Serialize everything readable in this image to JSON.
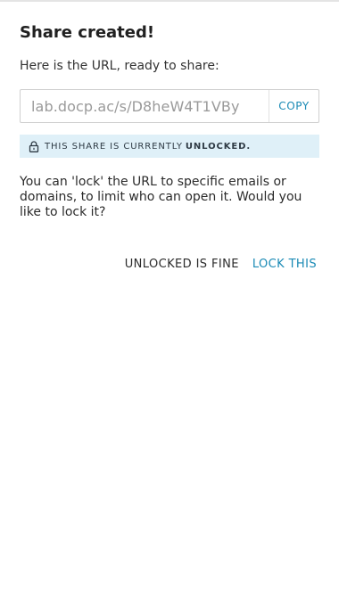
{
  "dialog": {
    "title": "Share created!",
    "intro": "Here is the URL, ready to share:",
    "url_value": "lab.docp.ac/s/D8heW4T1VBy",
    "copy_label": "COPY",
    "status": {
      "prefix": "THIS SHARE IS CURRENTLY",
      "state": "UNLOCKED.",
      "icon": "lock-icon",
      "background_color": "#dff0f8"
    },
    "body": "You can 'lock' the URL to specific emails or domains, to limit who can open it. Would you like to lock it?",
    "actions": {
      "secondary_label": "UNLOCKED IS FINE",
      "primary_label": "LOCK THIS"
    },
    "accent_color": "#1a8ab5"
  }
}
